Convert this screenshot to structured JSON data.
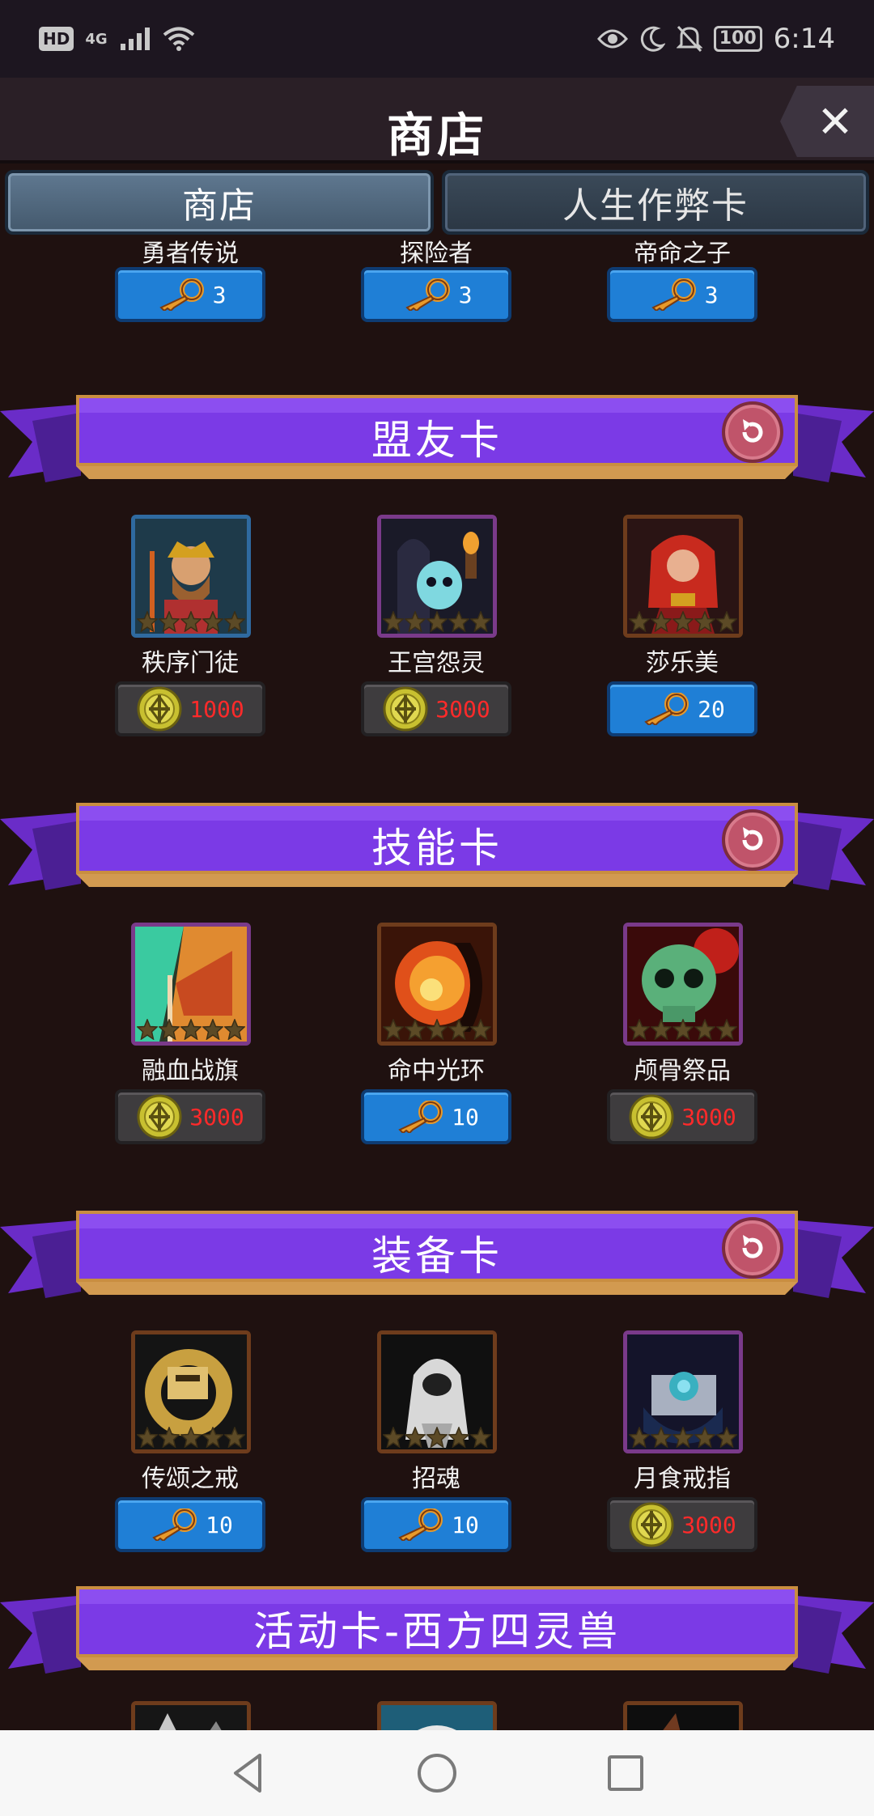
{
  "status_bar": {
    "hd": "HD",
    "network": "4G",
    "battery": "100",
    "time": "6:14",
    "icons": [
      "signal-icon",
      "wifi-icon",
      "eye-icon",
      "moon-icon",
      "bell-off-icon",
      "battery-icon"
    ]
  },
  "header": {
    "title": "商店",
    "close_icon": "close-icon"
  },
  "tabs": [
    {
      "label": "商店",
      "active": true
    },
    {
      "label": "人生作弊卡",
      "active": false
    }
  ],
  "top_row": [
    {
      "name": "勇者传说",
      "price_type": "key",
      "price": "3"
    },
    {
      "name": "探险者",
      "price_type": "key",
      "price": "3"
    },
    {
      "name": "帝命之子",
      "price_type": "key",
      "price": "3"
    }
  ],
  "sections": [
    {
      "title": "盟友卡",
      "refresh_icon": "refresh-icon",
      "cards": [
        {
          "name": "秩序门徒",
          "price_type": "coin",
          "price": "1000",
          "frame": "blue"
        },
        {
          "name": "王宫怨灵",
          "price_type": "coin",
          "price": "3000",
          "frame": "purple"
        },
        {
          "name": "莎乐美",
          "price_type": "key",
          "price": "20",
          "frame": "orange"
        }
      ]
    },
    {
      "title": "技能卡",
      "refresh_icon": "refresh-icon",
      "cards": [
        {
          "name": "融血战旗",
          "price_type": "coin",
          "price": "3000",
          "frame": "purple"
        },
        {
          "name": "命中光环",
          "price_type": "key",
          "price": "10",
          "frame": "orange"
        },
        {
          "name": "颅骨祭品",
          "price_type": "coin",
          "price": "3000",
          "frame": "purple"
        }
      ]
    },
    {
      "title": "装备卡",
      "refresh_icon": "refresh-icon",
      "cards": [
        {
          "name": "传颂之戒",
          "price_type": "key",
          "price": "10",
          "frame": "orange"
        },
        {
          "name": "招魂",
          "price_type": "key",
          "price": "10",
          "frame": "orange"
        },
        {
          "name": "月食戒指",
          "price_type": "coin",
          "price": "3000",
          "frame": "purple"
        }
      ]
    },
    {
      "title": "活动卡-西方四灵兽"
    }
  ],
  "nav_bar": {
    "icons": [
      "back-icon",
      "home-icon",
      "recents-icon"
    ]
  }
}
